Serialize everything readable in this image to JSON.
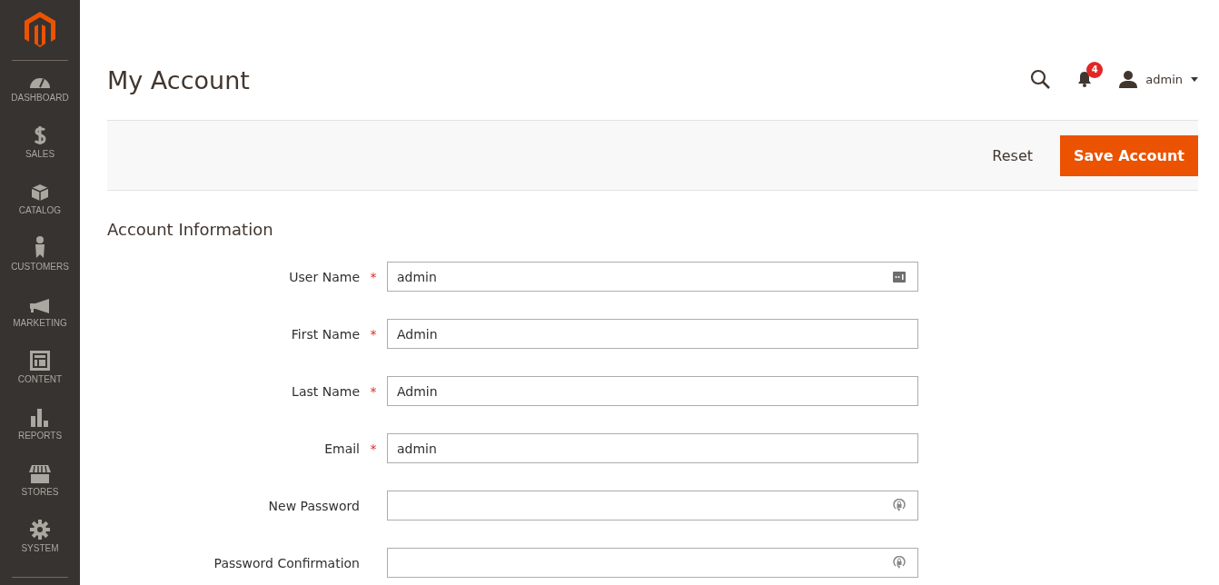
{
  "sidebar": {
    "items": [
      {
        "kind": "dashboard",
        "label": "DASHBOARD"
      },
      {
        "kind": "sales",
        "label": "SALES"
      },
      {
        "kind": "catalog",
        "label": "CATALOG"
      },
      {
        "kind": "customers",
        "label": "CUSTOMERS"
      },
      {
        "kind": "marketing",
        "label": "MARKETING"
      },
      {
        "kind": "content",
        "label": "CONTENT"
      },
      {
        "kind": "reports",
        "label": "REPORTS"
      },
      {
        "kind": "stores",
        "label": "STORES"
      },
      {
        "kind": "system",
        "label": "SYSTEM"
      }
    ]
  },
  "header": {
    "title": "My Account",
    "notifications": "4",
    "user": "admin"
  },
  "actions": {
    "reset": "Reset",
    "save": "Save Account"
  },
  "section": {
    "title": "Account Information",
    "fields": [
      {
        "kind": "username",
        "label": "User Name",
        "required": true,
        "required_mark": "*",
        "value": "admin"
      },
      {
        "kind": "text",
        "label": "First Name",
        "required": true,
        "required_mark": "*",
        "value": "Admin"
      },
      {
        "kind": "text",
        "label": "Last Name",
        "required": true,
        "required_mark": "*",
        "value": "Admin"
      },
      {
        "kind": "text",
        "label": "Email",
        "required": true,
        "required_mark": "*",
        "value": "admin"
      },
      {
        "kind": "password",
        "label": "New Password",
        "required": false
      },
      {
        "kind": "password",
        "label": "Password Confirmation",
        "required": false
      }
    ]
  }
}
